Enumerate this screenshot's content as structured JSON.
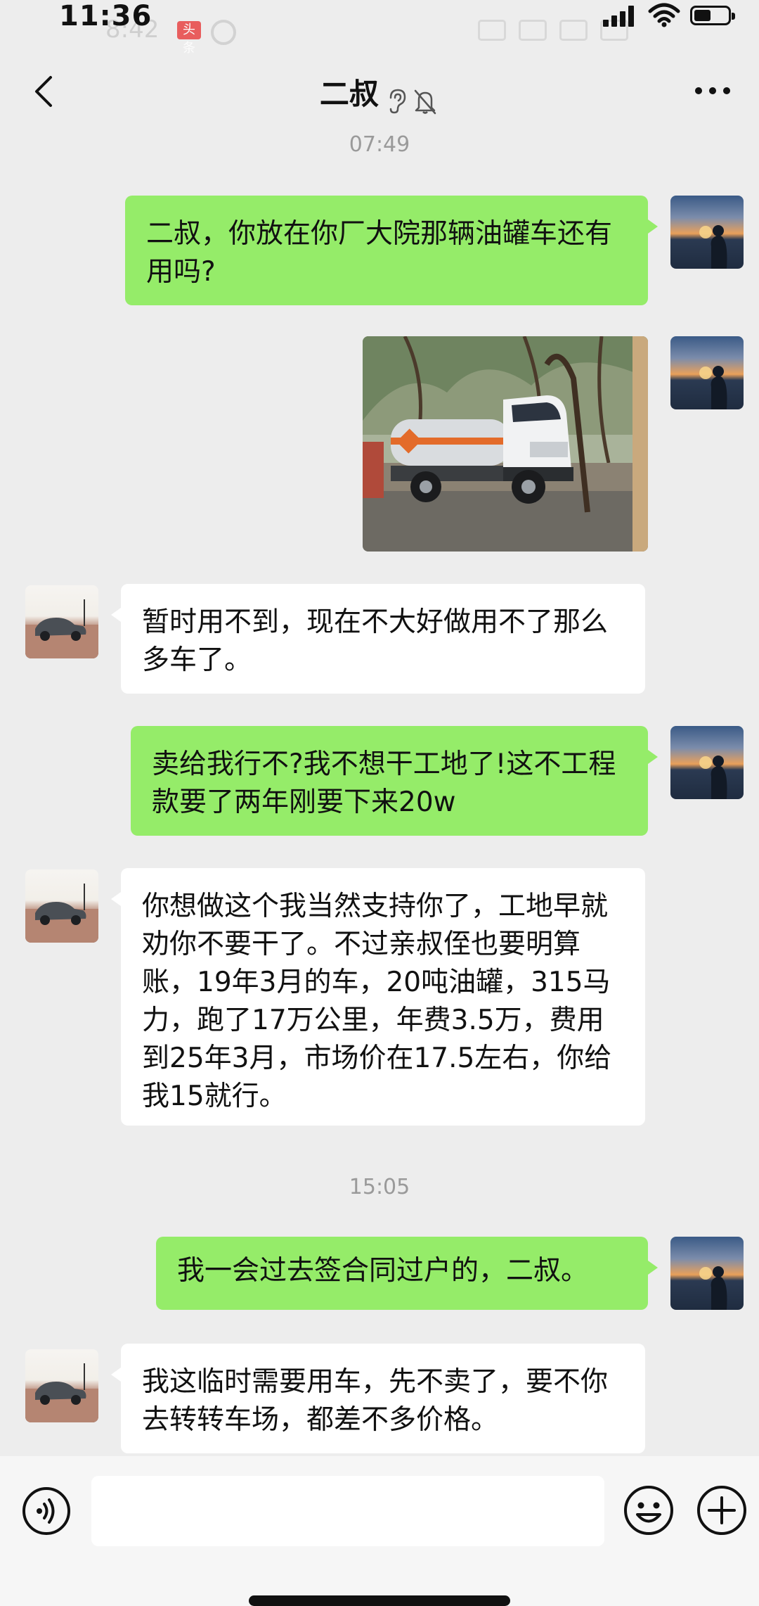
{
  "status_bar": {
    "time": "11:36",
    "ghost_time": "8:42",
    "ghost_badge": "头条",
    "battery_level": 0.5
  },
  "nav": {
    "title": "二叔",
    "icons": [
      "back-arrow-icon",
      "ear-icon",
      "mute-bell-icon",
      "more-icon"
    ]
  },
  "timestamps": [
    "07:49",
    "15:05"
  ],
  "messages": [
    {
      "side": "me",
      "text": "二叔，你放在你厂大院那辆油罐车还有用吗?"
    },
    {
      "side": "me",
      "type": "image",
      "content": "oil tanker truck photo"
    },
    {
      "side": "them",
      "text": "暂时用不到，现在不大好做用不了那么多车了。"
    },
    {
      "side": "me",
      "text": "卖给我行不?我不想干工地了!这不工程款要了两年刚要下来20w"
    },
    {
      "side": "them",
      "text": "你想做这个我当然支持你了，工地早就劝你不要干了。不过亲叔侄也要明算账，19年3月的车，20吨油罐，315马力，跑了17万公里，年费3.5万，费用到25年3月，市场价在17.5左右，你给我15就行。"
    },
    {
      "side": "me",
      "text": "我一会过去签合同过户的，二叔。"
    },
    {
      "side": "them",
      "text": "我这临时需要用车，先不卖了，要不你去转转车场，都差不多价格。"
    }
  ],
  "input_bar": {
    "icons": [
      "voice-icon",
      "emoji-icon",
      "plus-icon"
    ],
    "text_value": ""
  },
  "colors": {
    "background": "#ededed",
    "my_bubble": "#95ec69",
    "their_bubble": "#ffffff",
    "timestamp": "#9a9a9a"
  }
}
